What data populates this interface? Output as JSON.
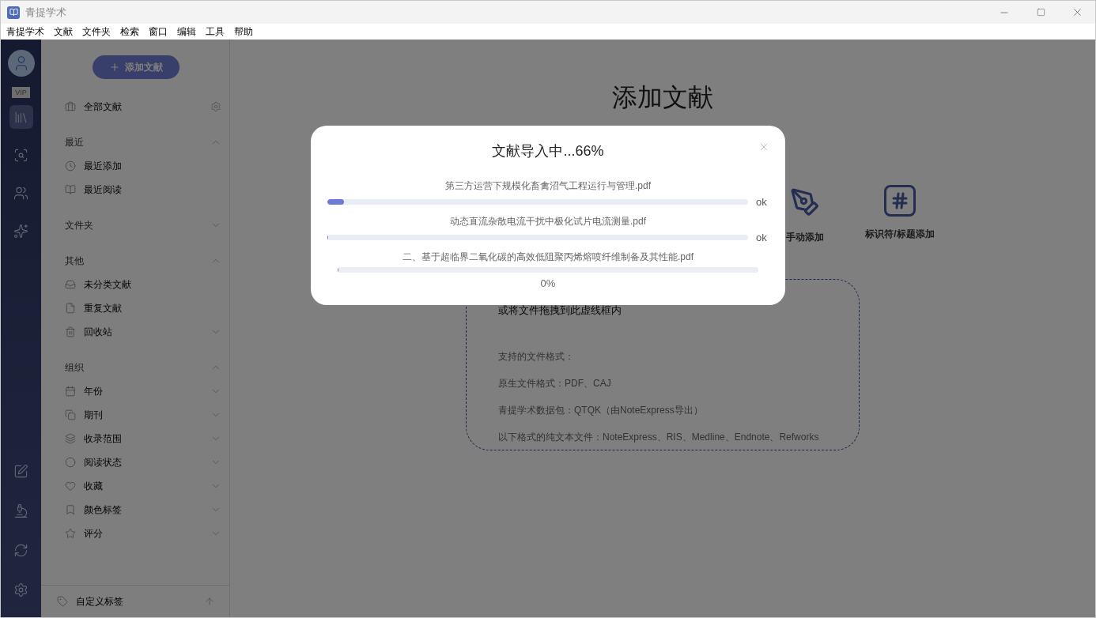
{
  "window": {
    "title": "青提学术"
  },
  "menu": [
    "青提学术",
    "文献",
    "文件夹",
    "检索",
    "窗口",
    "编辑",
    "工具",
    "帮助"
  ],
  "nav_rail": {
    "badge": "VIP",
    "items": [
      {
        "selected": true
      },
      {
        "selected": false
      },
      {
        "selected": false
      },
      {
        "selected": false
      }
    ]
  },
  "sidebar": {
    "add_button": "添加文献",
    "all_item": "全部文献",
    "sections": [
      {
        "title": "最近",
        "expanded": true,
        "items": [
          {
            "label": "最近添加",
            "expandable": false
          },
          {
            "label": "最近阅读",
            "expandable": false
          }
        ]
      },
      {
        "title": "文件夹",
        "expanded": false
      },
      {
        "title": "其他",
        "expanded": true,
        "items": [
          {
            "label": "未分类文献",
            "expandable": false
          },
          {
            "label": "重复文献",
            "expandable": false
          },
          {
            "label": "回收站",
            "expandable": true
          }
        ]
      },
      {
        "title": "组织",
        "expanded": true,
        "items": [
          {
            "label": "年份",
            "expandable": true
          },
          {
            "label": "期刊",
            "expandable": true
          },
          {
            "label": "收录范围",
            "expandable": true
          },
          {
            "label": "阅读状态",
            "expandable": true
          },
          {
            "label": "收藏",
            "expandable": true
          },
          {
            "label": "颜色标签",
            "expandable": true
          },
          {
            "label": "评分",
            "expandable": true
          }
        ]
      }
    ],
    "footer": "自定义标签"
  },
  "main": {
    "title": "添加文献",
    "methods": [
      {
        "kind": "manual",
        "label": "手动添加"
      },
      {
        "kind": "identifier",
        "label": "标识符/标题添加"
      }
    ],
    "drop_zone": {
      "title": "或将文件拖拽到此虚线框内",
      "lines": [
        "支持的文件格式：",
        "原生文件格式：PDF、CAJ",
        "青提学术数据包：QTQK（由NoteExpress导出）",
        "以下格式的纯文本文件：NoteExpress、RIS、Medline、Endnote、Refworks"
      ]
    }
  },
  "import_dialog": {
    "title": "文献导入中...66%",
    "files": [
      {
        "name": "第三方运营下规模化畜禽沼气工程运行与管理.pdf",
        "level": 0.04,
        "status": "ok"
      },
      {
        "name": "动态直流杂散电流干扰中极化试片电流测量.pdf",
        "level": 0,
        "status": "ok"
      },
      {
        "name": "二、基于超临界二氧化碳的高效低阻聚丙烯熔喷纤维制备及其性能.pdf",
        "level": 0,
        "progress": "0%"
      }
    ]
  }
}
